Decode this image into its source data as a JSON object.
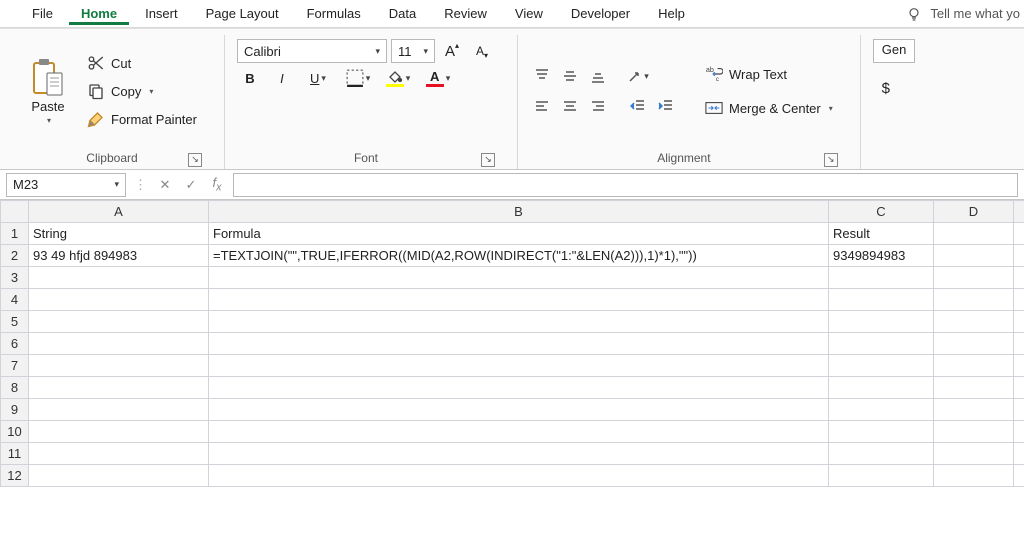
{
  "menu": {
    "tabs": [
      "File",
      "Home",
      "Insert",
      "Page Layout",
      "Formulas",
      "Data",
      "Review",
      "View",
      "Developer",
      "Help"
    ],
    "active": "Home",
    "tellme": "Tell me what yo"
  },
  "ribbon": {
    "clipboard": {
      "paste": "Paste",
      "cut": "Cut",
      "copy": "Copy",
      "format_painter": "Format Painter",
      "label": "Clipboard"
    },
    "font": {
      "family": "Calibri",
      "size": "11",
      "bold": "B",
      "italic": "I",
      "underline": "U",
      "label": "Font"
    },
    "alignment": {
      "wrap": "Wrap Text",
      "merge": "Merge & Center",
      "label": "Alignment"
    },
    "number": {
      "general": "Gen",
      "currency": "$"
    }
  },
  "formula_bar": {
    "name_box": "M23",
    "formula": ""
  },
  "sheet": {
    "columns": [
      "A",
      "B",
      "C",
      "D",
      ""
    ],
    "rows": [
      "1",
      "2",
      "3",
      "4",
      "5",
      "6",
      "7",
      "8",
      "9",
      "10",
      "11",
      "12"
    ],
    "cells": {
      "A1": "String",
      "B1": "Formula",
      "C1": "Result",
      "A2": "93 49 hfjd 894983",
      "B2": "=TEXTJOIN(\"\",TRUE,IFERROR((MID(A2,ROW(INDIRECT(\"1:\"&LEN(A2))),1)*1),\"\"))",
      "C2": "9349894983"
    }
  }
}
